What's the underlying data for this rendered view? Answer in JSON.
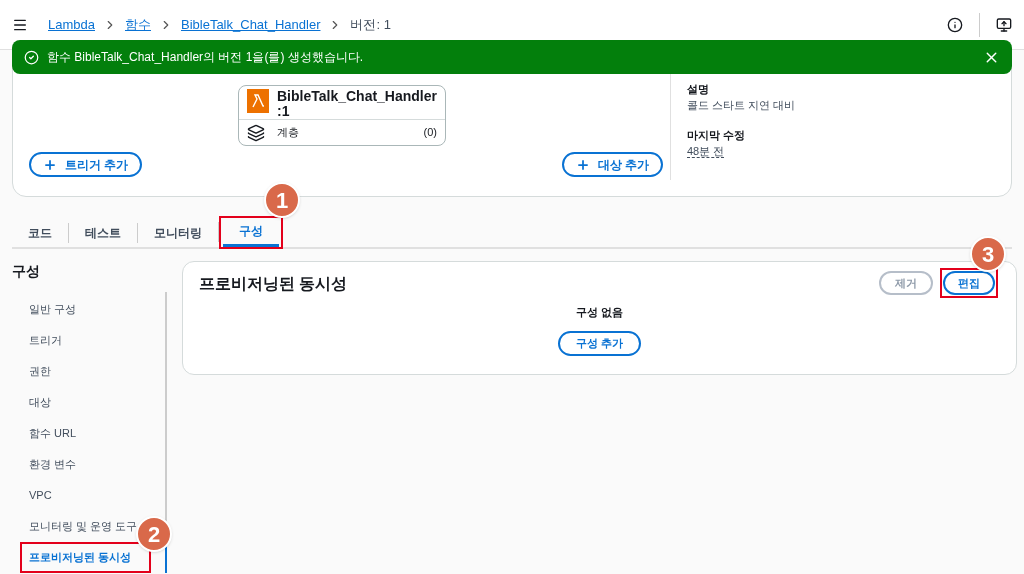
{
  "breadcrumbs": [
    {
      "label": "Lambda",
      "link": true
    },
    {
      "label": "함수",
      "link": true
    },
    {
      "label": "BibleTalk_Chat_Handler",
      "link": true
    },
    {
      "label": "버전: 1",
      "link": false
    }
  ],
  "banner": {
    "message": "함수 BibleTalk_Chat_Handler의 버전 1을(를) 생성했습니다."
  },
  "function_card": {
    "name": "BibleTalk_Chat_Handler",
    "version": ":1",
    "layers_label": "계층",
    "layers_count": "(0)"
  },
  "add_trigger": "트리거 추가",
  "add_destination": "대상 추가",
  "details": [
    {
      "label": "설명",
      "value": "콜드 스타트 지연 대비",
      "dotted": false
    },
    {
      "label": "마지막 수정",
      "value": "48분 전",
      "dotted": true
    }
  ],
  "tabs": [
    {
      "label": "코드",
      "selected": false
    },
    {
      "label": "테스트",
      "selected": false
    },
    {
      "label": "모니터링",
      "selected": false
    },
    {
      "label": "구성",
      "selected": true,
      "callout": "1"
    }
  ],
  "sidebar": {
    "title": "구성",
    "items": [
      {
        "label": "일반 구성",
        "selected": false
      },
      {
        "label": "트리거",
        "selected": false
      },
      {
        "label": "권한",
        "selected": false
      },
      {
        "label": "대상",
        "selected": false
      },
      {
        "label": "함수 URL",
        "selected": false
      },
      {
        "label": "환경 변수",
        "selected": false
      },
      {
        "label": "VPC",
        "selected": false
      },
      {
        "label": "모니터링 및 운영 도구",
        "selected": false
      },
      {
        "label": "프로비저닝된 동시성",
        "selected": true,
        "callout": "2"
      }
    ]
  },
  "panel": {
    "title": "프로비저닝된 동시성",
    "remove_button": {
      "label": "제거",
      "disabled": true
    },
    "edit_button": {
      "label": "편집",
      "callout": "3"
    },
    "empty_text": "구성 없음",
    "add_button": "구성 추가"
  }
}
